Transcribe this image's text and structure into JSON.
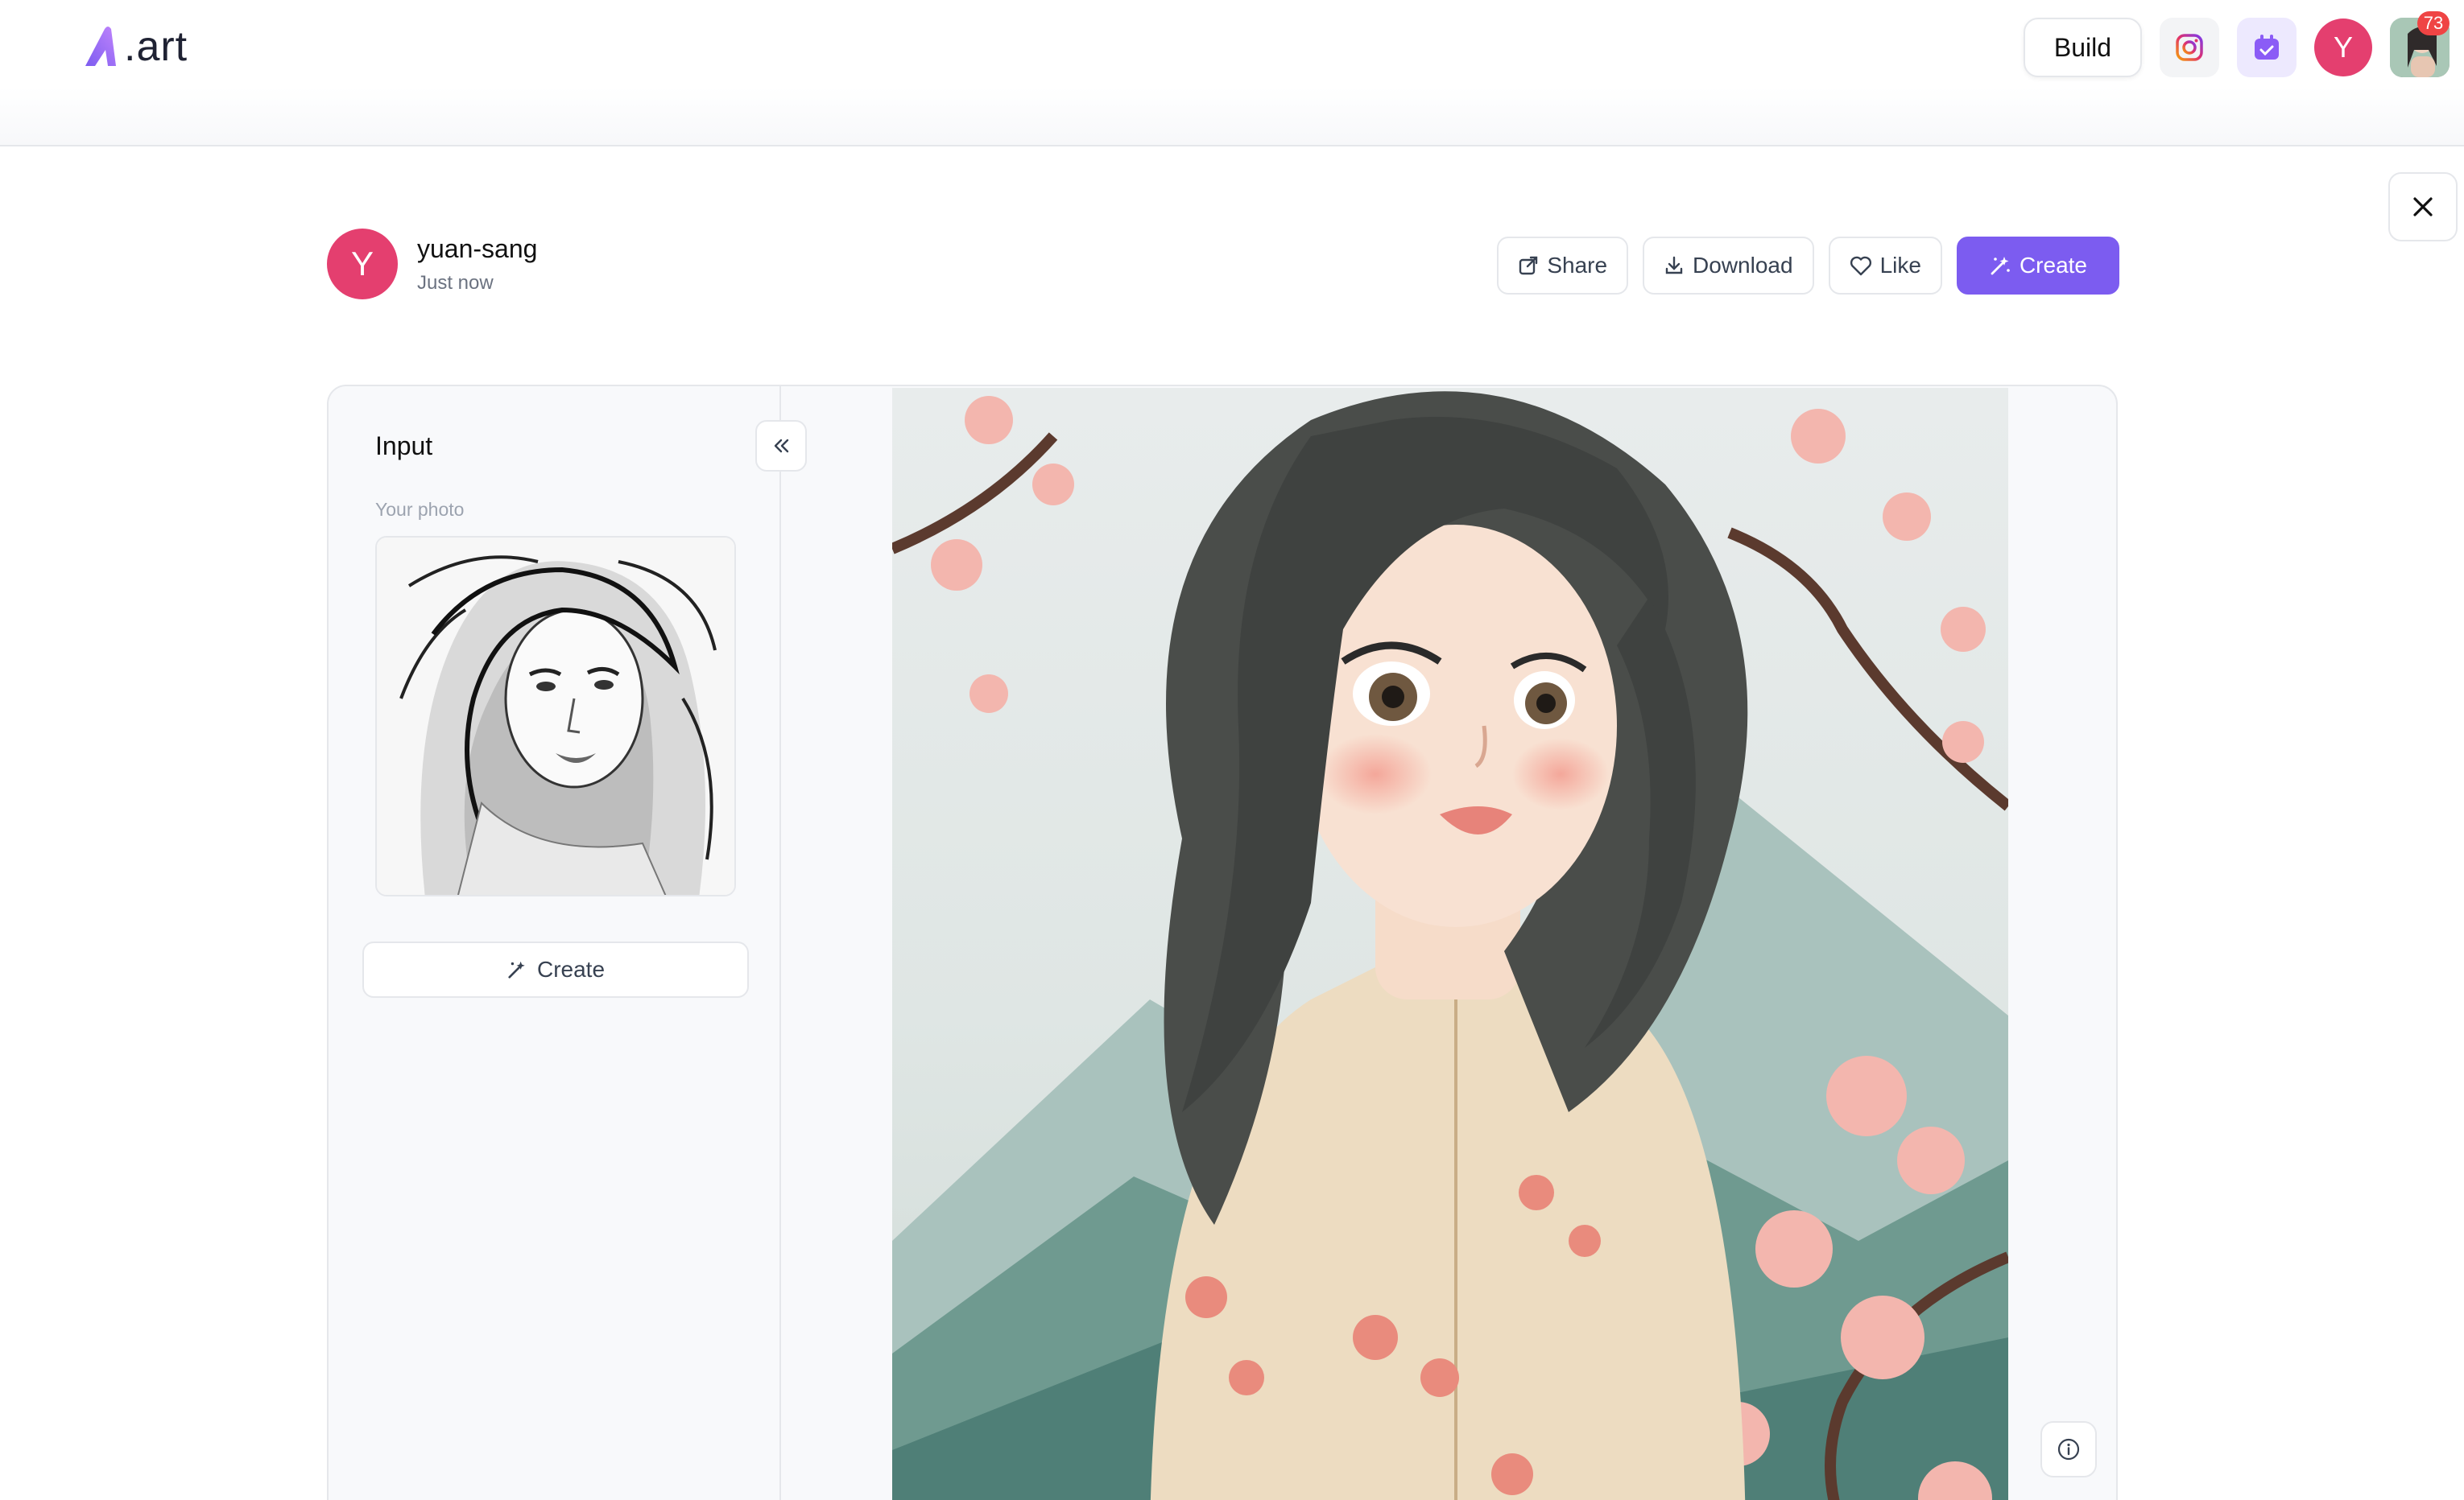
{
  "brand": {
    "logo_text": ".art"
  },
  "nav": {
    "build_label": "Build",
    "user_initial": "Y",
    "notification_count": "73"
  },
  "post": {
    "author_initial": "Y",
    "author_name": "yuan-sang",
    "timestamp": "Just now",
    "actions": {
      "share": "Share",
      "download": "Download",
      "like": "Like",
      "create": "Create"
    }
  },
  "panel": {
    "title": "Input",
    "photo_label": "Your photo",
    "create_label": "Create"
  },
  "colors": {
    "accent": "#7c5cf0",
    "avatar": "#e43f6f",
    "badge": "#ef4444"
  }
}
